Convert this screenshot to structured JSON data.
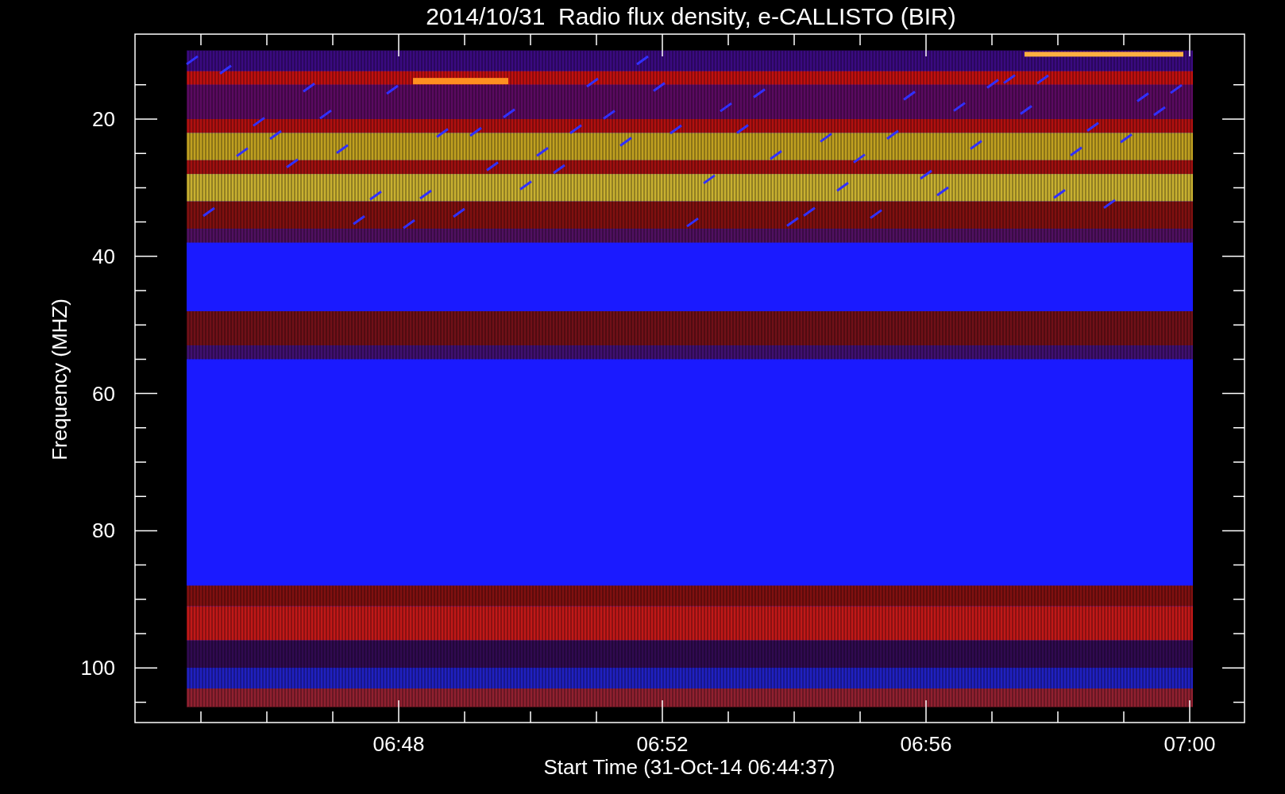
{
  "plot": {
    "title": "2014/10/31  Radio flux density, e-CALLISTO (BIR)",
    "ylabel": "Frequency (MHZ)",
    "xlabel": "Start Time (31-Oct-14 06:44:37)",
    "yticks": [
      "20",
      "40",
      "60",
      "80",
      "100"
    ],
    "xticks": [
      "06:48",
      "06:52",
      "06:56",
      "07:00"
    ]
  }
}
